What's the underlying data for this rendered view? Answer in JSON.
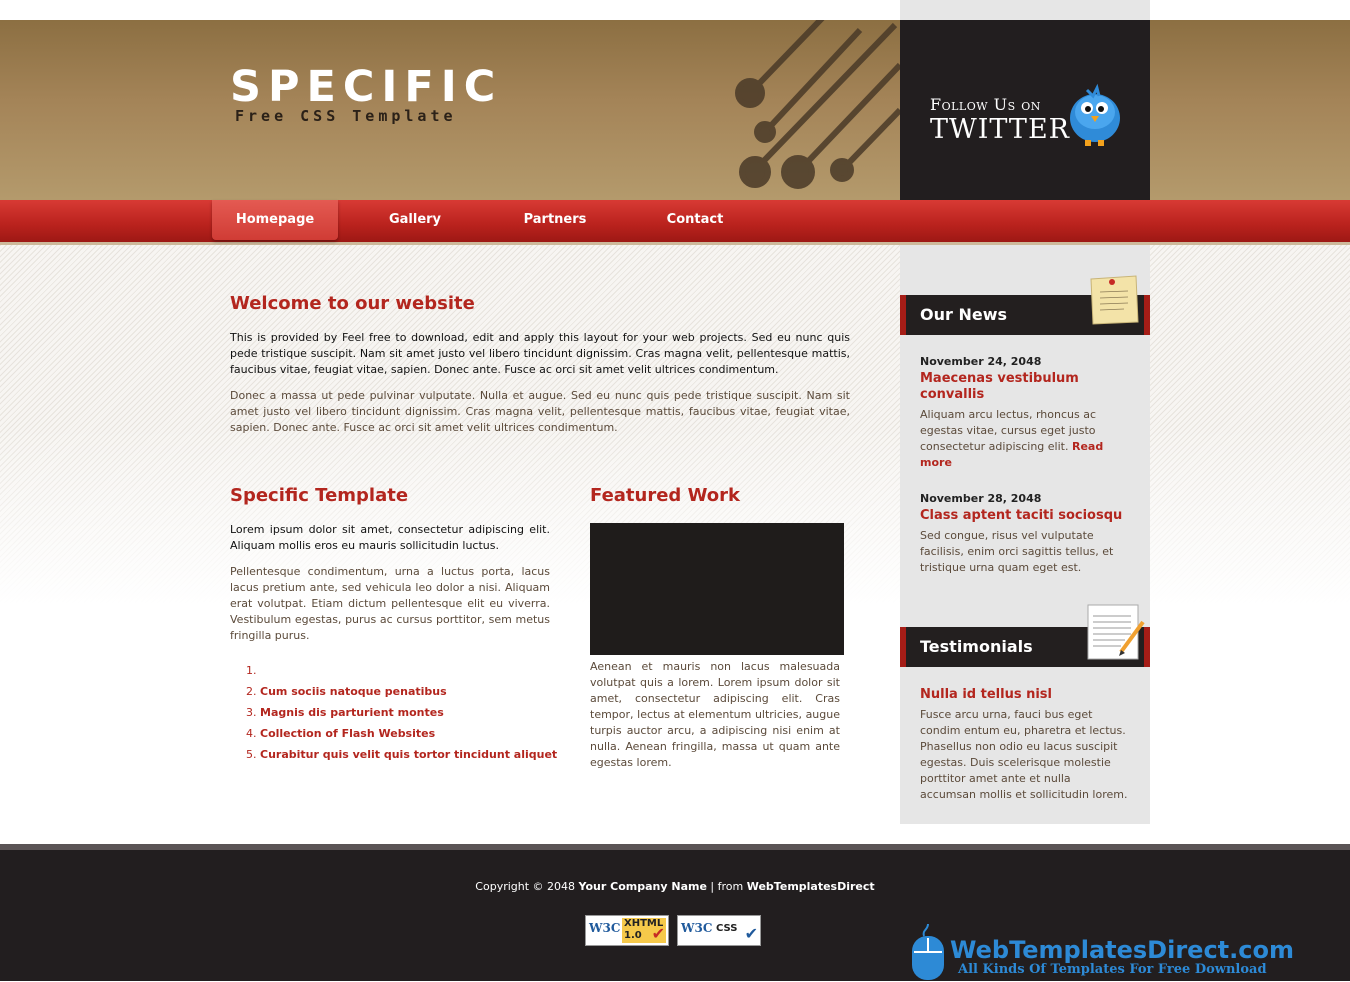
{
  "header": {
    "title": "SPECIFIC",
    "subtitle": "Free CSS Template",
    "twitter_follow": "Follow Us on",
    "twitter_name": "TWITTER"
  },
  "menu": {
    "items": [
      {
        "label": "Homepage"
      },
      {
        "label": "Gallery"
      },
      {
        "label": "Partners"
      },
      {
        "label": "Contact"
      }
    ]
  },
  "welcome": {
    "title": "Welcome to our website",
    "para1": "This is provided by Feel free to download, edit and apply this layout for your web projects. Sed eu nunc quis pede tristique suscipit. Nam sit amet justo vel libero tincidunt dignissim. Cras magna velit, pellentesque mattis, faucibus vitae, feugiat vitae, sapien. Donec ante. Fusce ac orci sit amet velit ultrices condimentum.",
    "para2": "Donec a massa ut pede pulvinar vulputate. Nulla et augue. Sed eu nunc quis pede tristique suscipit. Nam sit amet justo vel libero tincidunt dignissim. Cras magna velit, pellentesque mattis, faucibus vitae, feugiat vitae, sapien. Donec ante. Fusce ac orci sit amet velit ultrices condimentum."
  },
  "specific": {
    "title": "Specific Template",
    "para1": "Lorem ipsum dolor sit amet, consectetur adipiscing elit. Aliquam mollis eros eu mauris sollicitudin luctus.",
    "para2": "Pellentesque condimentum, urna a luctus porta, lacus lacus pretium ante, sed vehicula leo dolor a nisi. Aliquam erat volutpat. Etiam dictum pellentesque elit eu viverra. Vestibulum egestas, purus ac cursus porttitor, sem metus fringilla purus.",
    "list": [
      "",
      "Cum sociis natoque penatibus",
      "Magnis dis parturient montes",
      "Collection of Flash Websites",
      "Curabitur quis velit quis tortor tincidunt aliquet"
    ]
  },
  "featured": {
    "title": "Featured Work",
    "text": "Aenean et mauris non lacus malesuada volutpat quis a lorem. Lorem ipsum dolor sit amet, consectetur adipiscing elit. Cras tempor, lectus at elementum ultricies, augue turpis auctor arcu, a adipiscing nisi enim at nulla. Aenean fringilla, massa ut quam ante egestas lorem."
  },
  "news": {
    "title": "Our News",
    "items": [
      {
        "date": "November 24, 2048",
        "title": "Maecenas vestibulum convallis",
        "text": "Aliquam arcu lectus, rhoncus ac egestas vitae, cursus eget justo consectetur adipiscing elit.",
        "more": "Read more"
      },
      {
        "date": "November 28, 2048",
        "title": "Class aptent taciti sociosqu",
        "text": "Sed congue, risus vel vulputate facilisis, enim orci sagittis tellus, et tristique urna quam eget est."
      }
    ]
  },
  "testimonials": {
    "title": "Testimonials",
    "item_title": "Nulla id tellus nisl",
    "item_text": "Fusce arcu urna, fauci bus eget condim entum eu, pharetra et lectus. Phasellus non odio eu lacus suscipit egestas. Duis scelerisque molestie porttitor amet ante et nulla accumsan mollis et sollicitudin lorem."
  },
  "footer": {
    "copyright_prefix": "Copyright © 2048",
    "company": "Your Company Name",
    "from_text": "| from",
    "provider": "WebTemplatesDirect",
    "badge_xhtml": "XHTML 1.0",
    "badge_css": "CSS",
    "badge_w3c": "W3C",
    "brand_name": "WebTemplatesDirect.com",
    "brand_tagline": "All Kinds Of Templates For Free Download"
  },
  "colors": {
    "accent": "#b3261e",
    "menu": "#c62a24",
    "header": "#a48458",
    "dark": "#221e1f",
    "brand_blue": "#2d8ad6"
  }
}
